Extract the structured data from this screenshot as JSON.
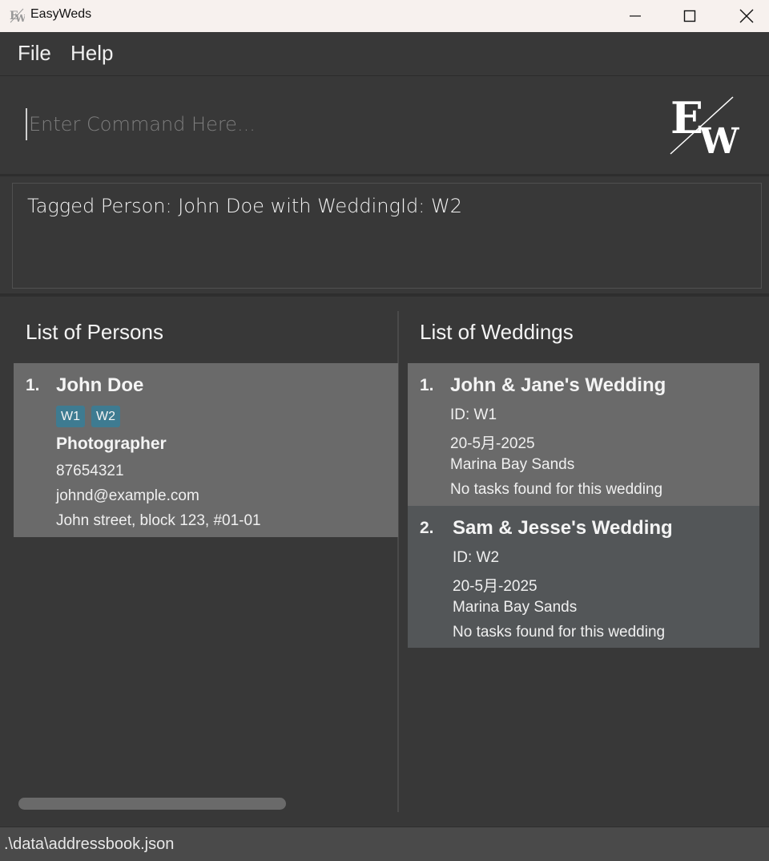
{
  "window": {
    "title": "EasyWeds"
  },
  "menu": {
    "file": "File",
    "help": "Help"
  },
  "command": {
    "placeholder": "Enter Command Here..."
  },
  "result": {
    "message": "Tagged Person: John Doe with WeddingId: W2"
  },
  "persons": {
    "title": "List of Persons",
    "items": [
      {
        "index": "1.",
        "name": "John Doe",
        "tags": [
          "W1",
          "W2"
        ],
        "role": "Photographer",
        "phone": "87654321",
        "email": "johnd@example.com",
        "address": "John street, block 123, #01-01"
      }
    ]
  },
  "weddings": {
    "title": "List of Weddings",
    "items": [
      {
        "index": "1.",
        "name": "John & Jane's Wedding",
        "id": "ID: W1",
        "date": "20-5月-2025",
        "venue": "Marina Bay Sands",
        "tasks": "No tasks found for this wedding"
      },
      {
        "index": "2.",
        "name": "Sam & Jesse's Wedding",
        "id": "ID: W2",
        "date": "20-5月-2025",
        "venue": "Marina Bay Sands",
        "tasks": "No tasks found for this wedding"
      }
    ]
  },
  "status": {
    "path": ".\\data\\addressbook.json"
  },
  "colors": {
    "tag": "#3e7b91",
    "background": "#383838",
    "card": "#6a6a6a",
    "card_selected": "#535658"
  }
}
